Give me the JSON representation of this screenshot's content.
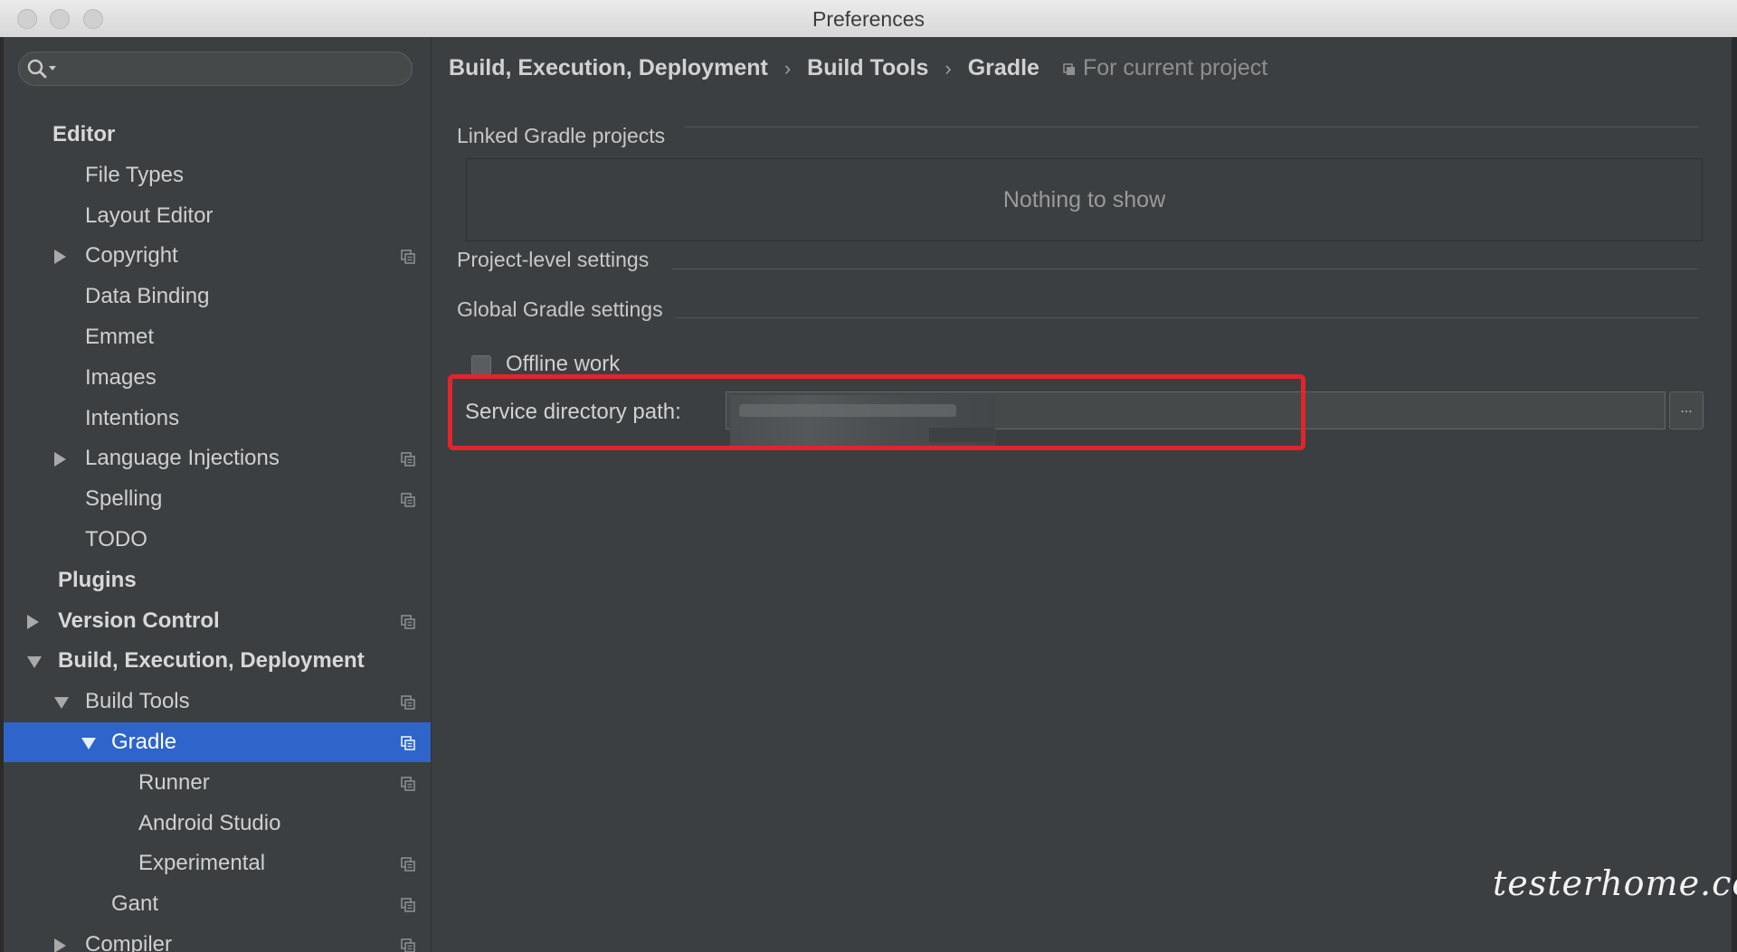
{
  "window": {
    "title": "Preferences"
  },
  "search": {
    "placeholder": ""
  },
  "sidebar": {
    "items": [
      {
        "label": "Editor",
        "indent": 1,
        "bold": true,
        "arrow": "none",
        "shared": false,
        "selected": false
      },
      {
        "label": "File Types",
        "indent": 2,
        "bold": false,
        "arrow": "none",
        "shared": false,
        "selected": false
      },
      {
        "label": "Layout Editor",
        "indent": 2,
        "bold": false,
        "arrow": "none",
        "shared": false,
        "selected": false
      },
      {
        "label": "Copyright",
        "indent": 2,
        "bold": false,
        "arrow": "right",
        "shared": true,
        "selected": false
      },
      {
        "label": "Data Binding",
        "indent": 2,
        "bold": false,
        "arrow": "none",
        "shared": false,
        "selected": false
      },
      {
        "label": "Emmet",
        "indent": 2,
        "bold": false,
        "arrow": "none",
        "shared": false,
        "selected": false
      },
      {
        "label": "Images",
        "indent": 2,
        "bold": false,
        "arrow": "none",
        "shared": false,
        "selected": false
      },
      {
        "label": "Intentions",
        "indent": 2,
        "bold": false,
        "arrow": "none",
        "shared": false,
        "selected": false
      },
      {
        "label": "Language Injections",
        "indent": 2,
        "bold": false,
        "arrow": "right",
        "shared": true,
        "selected": false
      },
      {
        "label": "Spelling",
        "indent": 2,
        "bold": false,
        "arrow": "none",
        "shared": true,
        "selected": false
      },
      {
        "label": "TODO",
        "indent": 2,
        "bold": false,
        "arrow": "none",
        "shared": false,
        "selected": false
      },
      {
        "label": "Plugins",
        "indent": 1,
        "bold": true,
        "arrow": "none",
        "shared": false,
        "selected": false
      },
      {
        "label": "Version Control",
        "indent": 1,
        "bold": true,
        "arrow": "right",
        "shared": true,
        "selected": false
      },
      {
        "label": "Build, Execution, Deployment",
        "indent": 1,
        "bold": true,
        "arrow": "down",
        "shared": false,
        "selected": false
      },
      {
        "label": "Build Tools",
        "indent": 2,
        "bold": false,
        "arrow": "down",
        "shared": true,
        "selected": false
      },
      {
        "label": "Gradle",
        "indent": 3,
        "bold": false,
        "arrow": "down",
        "shared": true,
        "selected": true
      },
      {
        "label": "Runner",
        "indent": 4,
        "bold": false,
        "arrow": "none",
        "shared": true,
        "selected": false
      },
      {
        "label": "Android Studio",
        "indent": 4,
        "bold": false,
        "arrow": "none",
        "shared": false,
        "selected": false
      },
      {
        "label": "Experimental",
        "indent": 4,
        "bold": false,
        "arrow": "none",
        "shared": true,
        "selected": false
      },
      {
        "label": "Gant",
        "indent": 3,
        "bold": false,
        "arrow": "none",
        "shared": true,
        "selected": false
      },
      {
        "label": "Compiler",
        "indent": 2,
        "bold": false,
        "arrow": "right",
        "shared": true,
        "selected": false
      }
    ]
  },
  "breadcrumb": {
    "items": [
      "Build, Execution, Deployment",
      "Build Tools",
      "Gradle"
    ],
    "separator": "›",
    "scope": "For current project"
  },
  "sections": {
    "linked": "Linked Gradle projects",
    "linked_empty": "Nothing to show",
    "project_level": "Project-level settings",
    "global": "Global Gradle settings"
  },
  "settings": {
    "offline_label": "Offline work",
    "offline_checked": false,
    "service_label": "Service directory path:",
    "service_value": "",
    "browse_label": "..."
  },
  "watermark": {
    "text": "testerhome.com"
  },
  "colors": {
    "selection": "#2f65ca",
    "highlight": "#e3242b",
    "background": "#3c3f41"
  }
}
